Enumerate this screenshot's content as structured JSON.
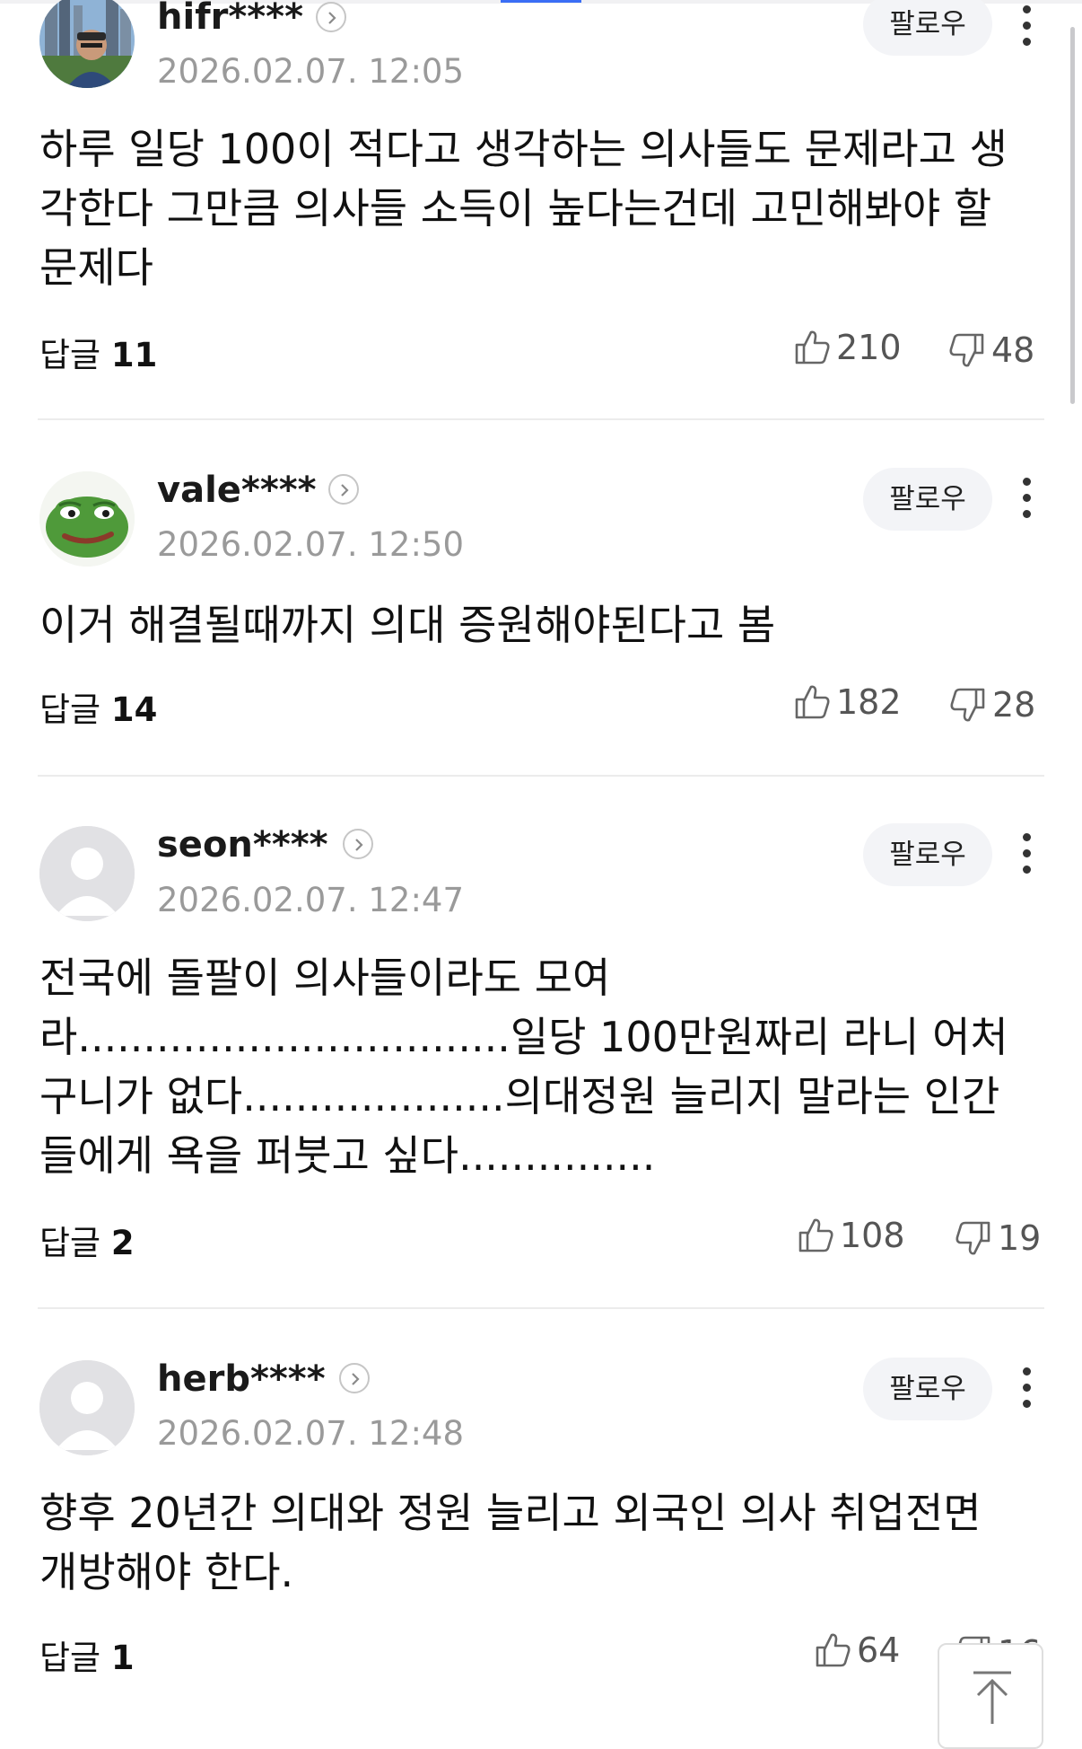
{
  "comments": [
    {
      "user": "hifr****",
      "timestamp": "2026.02.07. 12:05",
      "follow_label": "팔로우",
      "body": "하루 일당 100이 적다고 생각하는 의사들도 문제라고 생각한다 그만큼 의사들 소득이 높다는건데 고민해봐야 할 문제다",
      "reply_label": "답글",
      "reply_count": "11",
      "likes": "210",
      "dislikes": "48",
      "avatar": "photo-avatar"
    },
    {
      "user": "vale****",
      "timestamp": "2026.02.07. 12:50",
      "follow_label": "팔로우",
      "body": "이거 해결될때까지 의대 증원해야된다고 봄",
      "reply_label": "답글",
      "reply_count": "14",
      "likes": "182",
      "dislikes": "28",
      "avatar": "frog-avatar"
    },
    {
      "user": "seon****",
      "timestamp": "2026.02.07. 12:47",
      "follow_label": "팔로우",
      "body": "전국에 돌팔이 의사들이라도 모여라.................................일당 100만원짜리 라니 어처구니가 없다....................의대정원 늘리지 말라는 인간들에게 욕을 퍼붓고 싶다...............",
      "reply_label": "답글",
      "reply_count": "2",
      "likes": "108",
      "dislikes": "19",
      "avatar": "default-avatar"
    },
    {
      "user": "herb****",
      "timestamp": "2026.02.07. 12:48",
      "follow_label": "팔로우",
      "body": "향후 20년간 의대와 정원 늘리고 외국인 의사 취업전면 개방해야 한다.",
      "reply_label": "답글",
      "reply_count": "1",
      "likes": "64",
      "dislikes": "16",
      "avatar": "default-avatar"
    }
  ],
  "icons": {
    "like": "thumbs-up-icon",
    "dislike": "thumbs-down-icon",
    "more": "more-vertical-icon",
    "chevron": "chevron-right-icon",
    "scroll_top": "arrow-up-icon"
  },
  "colors": {
    "timestamp": "#9a9a9a",
    "follow_bg": "#f3f4f7",
    "divider": "#ececec",
    "tab_indicator": "#3b6ef5"
  }
}
